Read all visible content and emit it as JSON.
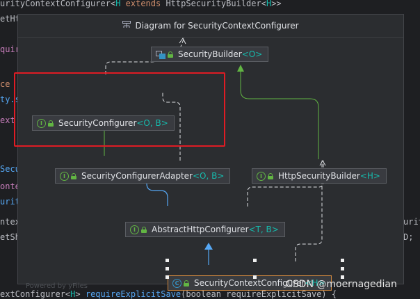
{
  "editor": {
    "lines": [
      {
        "t1": "urityContextConfigurer",
        "t2": "<",
        "t3": "H",
        "t4": " extends ",
        "t5": "HttpSecurityBuilder",
        "t6": "<",
        "t7": "H",
        "t8": ">>"
      },
      {
        "t1": "etHt"
      },
      {
        "t1": "quir"
      },
      {
        "t1": "ce"
      },
      {
        "t1": "ty.s"
      },
      {
        "t1": "ext"
      },
      {
        "t1": "Secu"
      },
      {
        "t1": "onte"
      },
      {
        "t1": "urit"
      },
      {
        "t1": "ntext"
      },
      {
        "t1": "etSh"
      },
      {
        "t1": "urit"
      },
      {
        "t1": "D;"
      },
      {
        "t1": "extConfigurer",
        "t2": "<",
        "t3": "H",
        "t4": "> ",
        "t5": "requireExplicitSave",
        "t6": "(boolean requireExplicitSave) {"
      }
    ]
  },
  "popup": {
    "title": "Diagram for SecurityContextConfigurer",
    "title_icon": "hierarchy-diagram-icon",
    "watermark": "Powered by yFiles"
  },
  "nodes": {
    "security_builder": {
      "name": "SecurityBuilder",
      "generic": "<O>",
      "kind": "interface"
    },
    "security_configurer": {
      "name": "SecurityConfigurer",
      "generic": "<O, B>",
      "kind": "interface"
    },
    "security_configurer_adapter": {
      "name": "SecurityConfigurerAdapter",
      "generic": "<O, B>",
      "kind": "interface"
    },
    "http_security_builder": {
      "name": "HttpSecurityBuilder",
      "generic": "<H>",
      "kind": "interface"
    },
    "abstract_http_configurer": {
      "name": "AbstractHttpConfigurer",
      "generic": "<T, B>",
      "kind": "interface"
    },
    "security_context_configurer": {
      "name": "SecurityContextConfigurer",
      "generic": "<H>",
      "kind": "class"
    }
  },
  "badges": {
    "interface": "I",
    "class": "C"
  },
  "colors": {
    "implements": "#62b543",
    "extends": "#56a8f5",
    "dependency": "#dfe1e5",
    "highlight": "#e01c24",
    "selected": "#d3893e"
  },
  "watermark_text": "CSDN @moernagedian"
}
